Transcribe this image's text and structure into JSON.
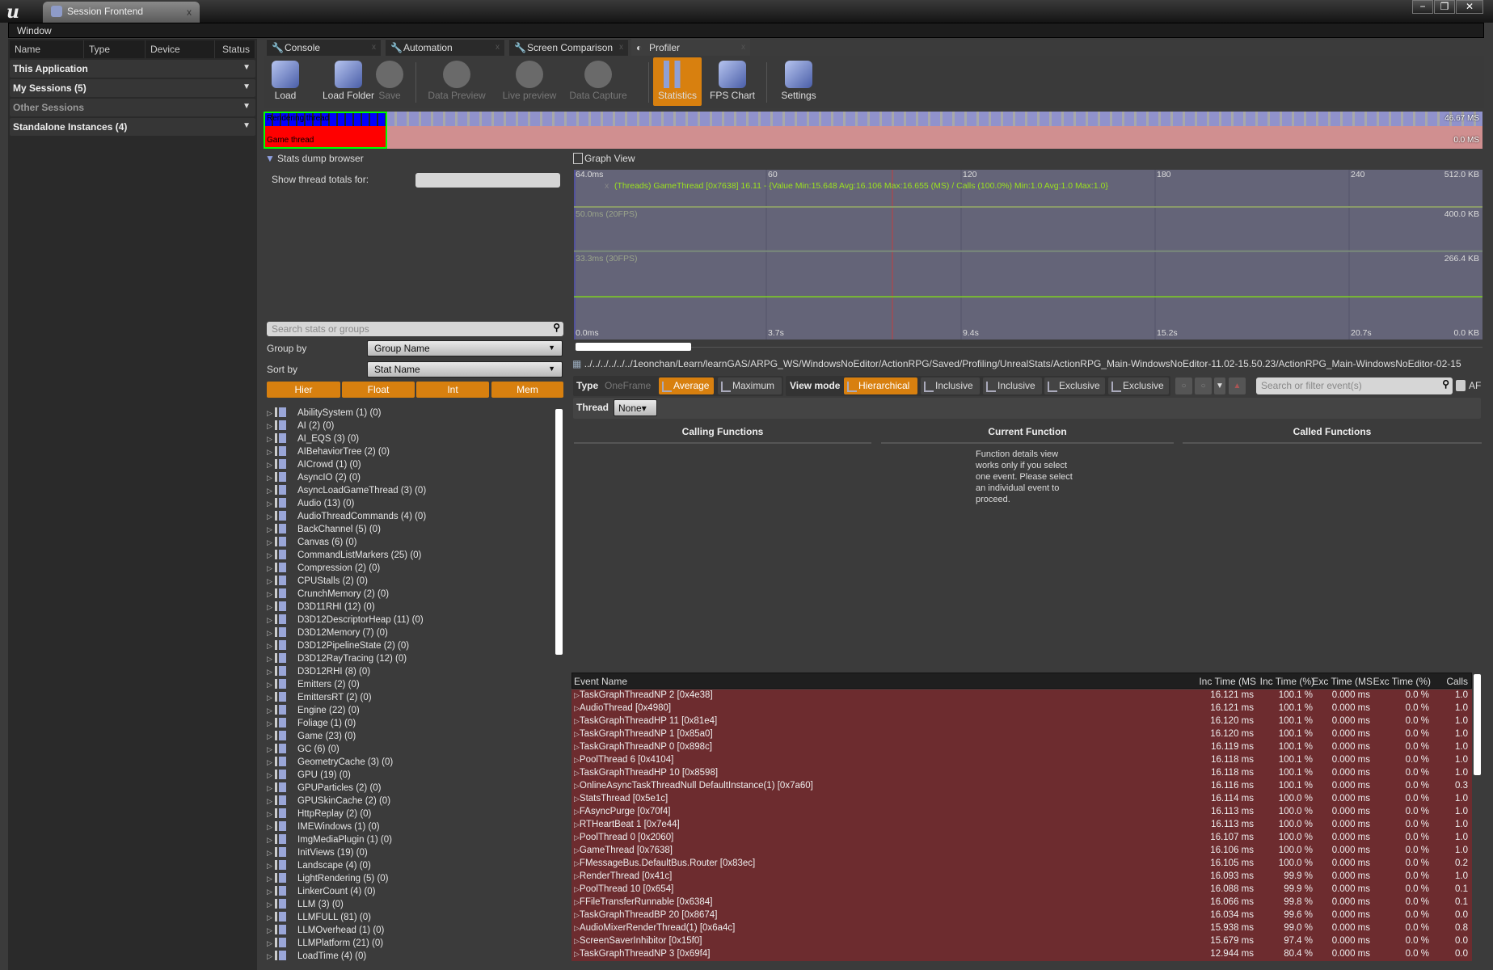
{
  "window": {
    "app_tab": "Session Frontend",
    "close": "x",
    "menu": "Window",
    "controls": [
      "−",
      "❐",
      "✕"
    ]
  },
  "sessions": {
    "columns": [
      "Name",
      "Type",
      "Device",
      "Status"
    ],
    "rows": [
      {
        "label": "This Application"
      },
      {
        "label": "My Sessions (5)"
      },
      {
        "label": "Other Sessions",
        "dim": true
      },
      {
        "label": "Standalone Instances (4)"
      }
    ]
  },
  "tabs": [
    {
      "label": "Console",
      "icon": "wrench-icon"
    },
    {
      "label": "Automation",
      "icon": "wrench-icon"
    },
    {
      "label": "Screen Comparison",
      "icon": "wrench-icon"
    },
    {
      "label": "Profiler",
      "icon": "profiler-icon",
      "active": true
    }
  ],
  "toolbar": [
    {
      "label": "Load"
    },
    {
      "label": "Load Folder"
    },
    {
      "label": "Save",
      "disabled": true
    },
    {
      "label": "Data Preview",
      "disabled": true
    },
    {
      "label": "Live preview",
      "disabled": true
    },
    {
      "label": "Data Capture",
      "disabled": true
    },
    {
      "label": "Statistics",
      "active": true
    },
    {
      "label": "FPS Chart"
    },
    {
      "label": "Settings"
    }
  ],
  "mini_timeline": {
    "rendering_label": "Rendering thread",
    "game_label": "Game thread",
    "max": "46.67 MS",
    "min": "0.0 MS"
  },
  "stats_browser": {
    "title": "Stats dump browser",
    "thread_totals_label": "Show thread totals for:",
    "search_placeholder": "Search stats or groups",
    "group_by_label": "Group by",
    "group_by_value": "Group Name",
    "sort_by_label": "Sort by",
    "sort_by_value": "Stat Name",
    "buttons": [
      "Hier",
      "Float",
      "Int",
      "Mem"
    ],
    "groups": [
      "AbilitySystem (1) (0)",
      "AI (2) (0)",
      "AI_EQS (3) (0)",
      "AIBehaviorTree (2) (0)",
      "AICrowd (1) (0)",
      "AsyncIO (2) (0)",
      "AsyncLoadGameThread (3) (0)",
      "Audio (13) (0)",
      "AudioThreadCommands (4) (0)",
      "BackChannel (5) (0)",
      "Canvas (6) (0)",
      "CommandListMarkers (25) (0)",
      "Compression (2) (0)",
      "CPUStalls (2) (0)",
      "CrunchMemory (2) (0)",
      "D3D11RHI (12) (0)",
      "D3D12DescriptorHeap (11) (0)",
      "D3D12Memory (7) (0)",
      "D3D12PipelineState (2) (0)",
      "D3D12RayTracing (12) (0)",
      "D3D12RHI (8) (0)",
      "Emitters (2) (0)",
      "EmittersRT (2) (0)",
      "Engine (22) (0)",
      "Foliage (1) (0)",
      "Game (23) (0)",
      "GC (6) (0)",
      "GeometryCache (3) (0)",
      "GPU (19) (0)",
      "GPUParticles (2) (0)",
      "GPUSkinCache (2) (0)",
      "HttpReplay (2) (0)",
      "IMEWindows (1) (0)",
      "ImgMediaPlugin (1) (0)",
      "InitViews (19) (0)",
      "Landscape (4) (0)",
      "LightRendering (5) (0)",
      "LinkerCount (4) (0)",
      "LLM (3) (0)",
      "LLMFULL (81) (0)",
      "LLMOverhead (1) (0)",
      "LLMPlatform (21) (0)",
      "LoadTime (4) (0)"
    ]
  },
  "graph": {
    "title": "Graph View",
    "y_top": "64.0ms",
    "y_bottom": "0.0ms",
    "y_max_ms": 64,
    "lines": [
      {
        "label": "50.0ms (20FPS)",
        "value_ms": 50,
        "right": "400.0 KB"
      },
      {
        "label": "33.3ms (30FPS)",
        "value_ms": 33.3,
        "right": "266.4 KB"
      }
    ],
    "right_top": "512.0 KB",
    "right_bottom": "0.0 KB",
    "frame_ticks": [
      "60",
      "120",
      "180",
      "240"
    ],
    "time_ticks": [
      "3.7s",
      "9.4s",
      "15.2s",
      "20.7s"
    ],
    "legend_close": "x",
    "legend": "(Threads) GameThread [0x7638] 16.11 - {Value Min:15.648 Avg:16.106 Max:16.655 (MS) / Calls (100.0%) Min:1.0 Avg:1.0 Max:1.0}",
    "series_ms": 16.11,
    "line_color": "#7fd41e"
  },
  "path": "../../../../../../1eonchan/Learn/learnGAS/ARPG_WS/WindowsNoEditor/ActionRPG/Saved/Profiling/UnrealStats/ActionRPG_Main-WindowsNoEditor-11.02-15.50.23/ActionRPG_Main-WindowsNoEditor-02-15",
  "filters": {
    "type_label": "Type",
    "type_options": [
      {
        "label": "OneFrame",
        "disabled": true
      },
      {
        "label": "Average",
        "active": true
      },
      {
        "label": "Maximum"
      }
    ],
    "view_mode_label": "View mode",
    "view_modes": [
      {
        "label": "Hierarchical",
        "active": true
      },
      {
        "label": "Inclusive"
      },
      {
        "label": "Inclusive"
      },
      {
        "label": "Exclusive"
      },
      {
        "label": "Exclusive"
      }
    ],
    "search_placeholder": "Search or filter event(s)",
    "af_label": "AF",
    "thread_label": "Thread",
    "thread_value": "None▾"
  },
  "function_details": {
    "calling": "Calling Functions",
    "current": "Current Function",
    "called": "Called Functions",
    "message": "Function details view works only if you select one event. Please select an individual event to proceed."
  },
  "events": {
    "columns": [
      "Event Name",
      "Inc Time (MS",
      "Inc Time (%)",
      "Exc Time (MS",
      "Exc Time (%)",
      "Calls"
    ],
    "rows": [
      [
        "TaskGraphThreadNP 2 [0x4e38]",
        "16.121 ms",
        "100.1 %",
        "0.000 ms",
        "0.0 %",
        "1.0"
      ],
      [
        "AudioThread [0x4980]",
        "16.121 ms",
        "100.1 %",
        "0.000 ms",
        "0.0 %",
        "1.0"
      ],
      [
        "TaskGraphThreadHP 11 [0x81e4]",
        "16.120 ms",
        "100.1 %",
        "0.000 ms",
        "0.0 %",
        "1.0"
      ],
      [
        "TaskGraphThreadNP 1 [0x85a0]",
        "16.120 ms",
        "100.1 %",
        "0.000 ms",
        "0.0 %",
        "1.0"
      ],
      [
        "TaskGraphThreadNP 0 [0x898c]",
        "16.119 ms",
        "100.1 %",
        "0.000 ms",
        "0.0 %",
        "1.0"
      ],
      [
        "PoolThread 6 [0x4104]",
        "16.118 ms",
        "100.1 %",
        "0.000 ms",
        "0.0 %",
        "1.0"
      ],
      [
        "TaskGraphThreadHP 10 [0x8598]",
        "16.118 ms",
        "100.1 %",
        "0.000 ms",
        "0.0 %",
        "1.0"
      ],
      [
        "OnlineAsyncTaskThreadNull DefaultInstance(1) [0x7a60]",
        "16.116 ms",
        "100.1 %",
        "0.000 ms",
        "0.0 %",
        "0.3"
      ],
      [
        "StatsThread [0x5e1c]",
        "16.114 ms",
        "100.0 %",
        "0.000 ms",
        "0.0 %",
        "1.0"
      ],
      [
        "FAsyncPurge [0x70f4]",
        "16.113 ms",
        "100.0 %",
        "0.000 ms",
        "0.0 %",
        "1.0"
      ],
      [
        "RTHeartBeat 1 [0x7e44]",
        "16.113 ms",
        "100.0 %",
        "0.000 ms",
        "0.0 %",
        "1.0"
      ],
      [
        "PoolThread 0 [0x2060]",
        "16.107 ms",
        "100.0 %",
        "0.000 ms",
        "0.0 %",
        "1.0"
      ],
      [
        "GameThread [0x7638]",
        "16.106 ms",
        "100.0 %",
        "0.000 ms",
        "0.0 %",
        "1.0"
      ],
      [
        "FMessageBus.DefaultBus.Router [0x83ec]",
        "16.105 ms",
        "100.0 %",
        "0.000 ms",
        "0.0 %",
        "0.2"
      ],
      [
        "RenderThread [0x41c]",
        "16.093 ms",
        "99.9 %",
        "0.000 ms",
        "0.0 %",
        "1.0"
      ],
      [
        "PoolThread 10 [0x654]",
        "16.088 ms",
        "99.9 %",
        "0.000 ms",
        "0.0 %",
        "0.1"
      ],
      [
        "FFileTransferRunnable [0x6384]",
        "16.066 ms",
        "99.8 %",
        "0.000 ms",
        "0.0 %",
        "0.1"
      ],
      [
        "TaskGraphThreadBP 20 [0x8674]",
        "16.034 ms",
        "99.6 %",
        "0.000 ms",
        "0.0 %",
        "0.0"
      ],
      [
        "AudioMixerRenderThread(1) [0x6a4c]",
        "15.938 ms",
        "99.0 %",
        "0.000 ms",
        "0.0 %",
        "0.8"
      ],
      [
        "ScreenSaverInhibitor [0x15f0]",
        "15.679 ms",
        "97.4 %",
        "0.000 ms",
        "0.0 %",
        "0.0"
      ],
      [
        "TaskGraphThreadNP 3 [0x69f4]",
        "12.944 ms",
        "80.4 %",
        "0.000 ms",
        "0.0 %",
        "0.0"
      ]
    ]
  },
  "colors": {
    "accent": "#d8800f",
    "event_row": "#6d2c2f",
    "graph_bg": "#646478"
  }
}
